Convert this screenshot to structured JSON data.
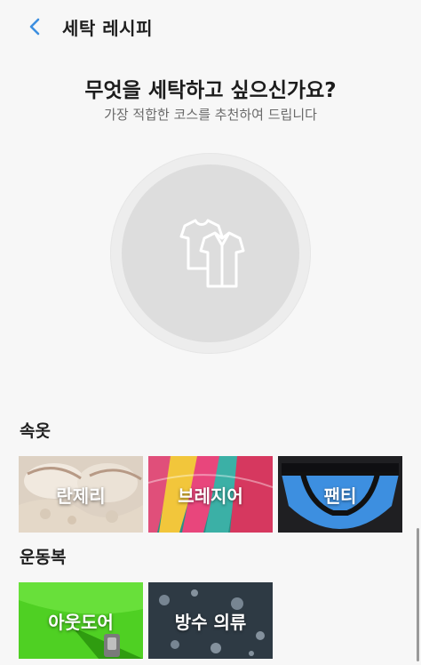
{
  "header": {
    "title": "세탁 레시피",
    "back_icon": "chevron-left-icon",
    "accent": "#3d8fe0"
  },
  "main": {
    "question": "무엇을 세탁하고 싶으신가요?",
    "subtitle": "가장 적합한 코스를 추천하여 드립니다",
    "placeholder_icon": "clothes-icon"
  },
  "sections": [
    {
      "title": "속옷",
      "items": [
        "란제리",
        "브레지어",
        "팬티"
      ]
    },
    {
      "title": "운동복",
      "items": [
        "아웃도어",
        "방수 의류"
      ]
    }
  ]
}
